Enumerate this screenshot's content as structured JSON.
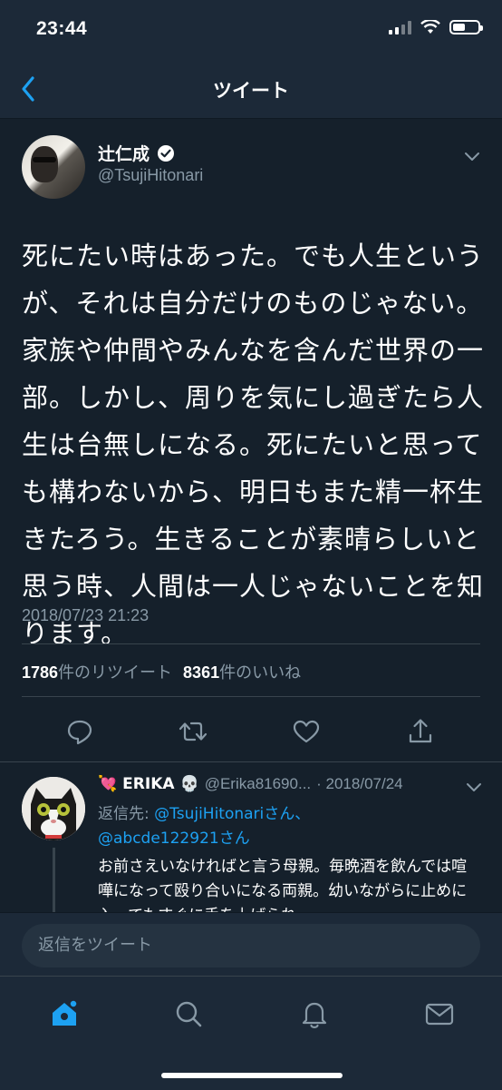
{
  "status_bar": {
    "time": "23:44",
    "battery_level": 0.5
  },
  "nav": {
    "title": "ツイート",
    "back_icon": "chevron-left-icon"
  },
  "tweet": {
    "display_name": "辻仁成",
    "handle": "@TsujiHitonari",
    "verified": true,
    "text": "死にたい時はあった。でも人生というが、それは自分だけのものじゃない。家族や仲間やみんなを含んだ世界の一部。しかし、周りを気にし過ぎたら人生は台無しになる。死にたいと思っても構わないから、明日もまた精一杯生きたろう。生きることが素晴らしいと思う時、人間は一人じゃないことを知ります。",
    "timestamp": "2018/07/23 21:23",
    "retweets": {
      "count": "1786",
      "label": "件のリツイート"
    },
    "likes": {
      "count": "8361",
      "label": "件のいいね"
    },
    "actions": [
      "reply-icon",
      "retweet-icon",
      "like-icon",
      "share-icon"
    ]
  },
  "reply": {
    "name_emoji_before": "💘",
    "display_name": "ERIKA",
    "name_emoji_after": "💀",
    "handle": "@Erika81690...",
    "date": "· 2018/07/24",
    "reply_to_label": "返信先: ",
    "reply_to_1": "@TsujiHitonariさん",
    "reply_to_sep": "、",
    "reply_to_2": "@abcde122921さん",
    "text": "お前さえいなければと言う母親。毎晩酒を飲んでは喧嘩になって殴り合いになる両親。幼いながらに止めに入ってもすぐに手を上げられ"
  },
  "composer": {
    "placeholder": "返信をツイート"
  },
  "tabs": [
    "home-icon",
    "search-icon",
    "notifications-icon",
    "messages-icon"
  ],
  "colors": {
    "background": "#15202b",
    "bar": "#1c2938",
    "accent": "#1da1f2",
    "secondary_text": "#8899a6",
    "divider": "#38444d"
  }
}
